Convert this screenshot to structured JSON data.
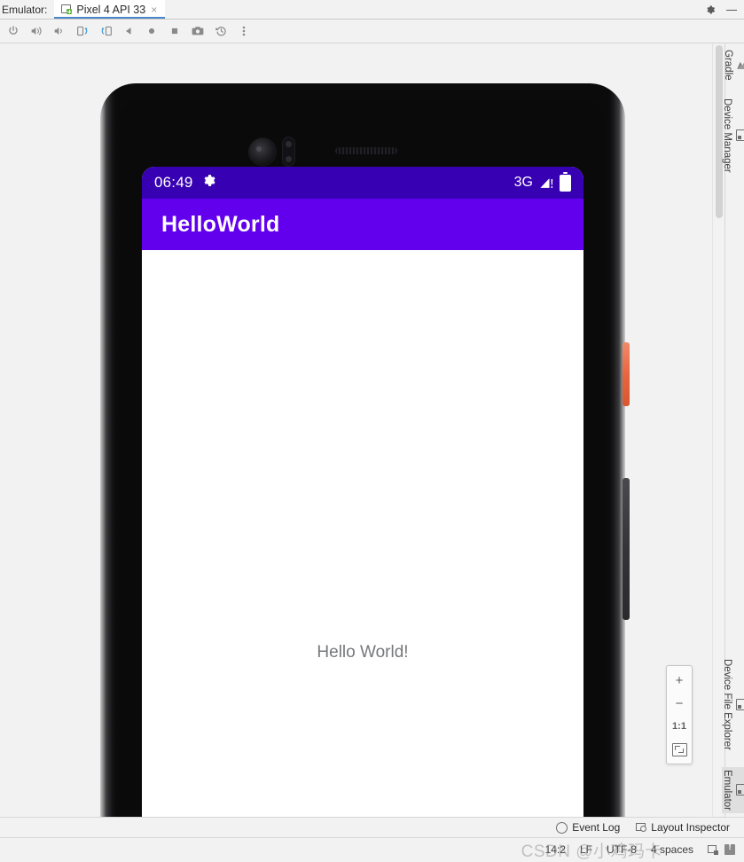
{
  "window": {
    "tool_window_label": "Emulator:",
    "settings_icon": "gear-icon",
    "minimize_icon": "minimize-icon"
  },
  "tabs": [
    {
      "label": "Pixel 4 API 33",
      "icon": "device-add-icon",
      "close": "×",
      "active": true
    }
  ],
  "emulator_toolbar": {
    "buttons": [
      {
        "name": "power-button",
        "icon": "power-icon",
        "label": "Power"
      },
      {
        "name": "volume-up-button",
        "icon": "volume-up-icon",
        "label": "Volume Up"
      },
      {
        "name": "volume-down-button",
        "icon": "volume-down-icon",
        "label": "Volume Down"
      },
      {
        "name": "rotate-left-button",
        "icon": "rotate-left-icon",
        "label": "Rotate Left"
      },
      {
        "name": "rotate-right-button",
        "icon": "rotate-right-icon",
        "label": "Rotate Right"
      },
      {
        "name": "back-button",
        "icon": "back-triangle-icon",
        "label": "Back"
      },
      {
        "name": "home-button",
        "icon": "home-circle-icon",
        "label": "Home"
      },
      {
        "name": "overview-button",
        "icon": "overview-square-icon",
        "label": "Overview"
      },
      {
        "name": "screenshot-button",
        "icon": "camera-icon",
        "label": "Take Screenshot"
      },
      {
        "name": "history-button",
        "icon": "history-icon",
        "label": "Snapshots"
      },
      {
        "name": "more-button",
        "icon": "more-vertical-icon",
        "label": "More"
      }
    ]
  },
  "device": {
    "name": "Pixel 4",
    "status_bar": {
      "time": "06:49",
      "settings_icon": "gear-icon",
      "network_type": "3G",
      "signal_icon": "signal-warning-icon",
      "battery_icon": "battery-full-icon",
      "background": "#3700B3",
      "foreground": "#FFFFFF"
    },
    "app_bar": {
      "title": "HelloWorld",
      "background": "#6200EE",
      "foreground": "#FFFFFF"
    },
    "content": {
      "text": "Hello World!",
      "text_color": "#77787A",
      "background": "#FFFFFF"
    },
    "hardware": {
      "power_button_color": "#E8663F",
      "volume_button_color": "#3A3A3C"
    }
  },
  "zoom_controls": {
    "zoom_in": "+",
    "zoom_out": "−",
    "actual_size": "1:1",
    "fit_icon": "fit-to-screen-icon"
  },
  "right_rail": {
    "top": [
      {
        "label": "Gradle",
        "icon": "gradle-icon"
      },
      {
        "label": "Device Manager",
        "icon": "device-manager-icon"
      }
    ],
    "bottom": [
      {
        "label": "Device File Explorer",
        "icon": "device-file-explorer-icon"
      },
      {
        "label": "Emulator",
        "icon": "emulator-icon",
        "active": true
      }
    ]
  },
  "status_bar": {
    "items": [
      {
        "label": "Event Log",
        "icon": "event-log-icon"
      },
      {
        "label": "Layout Inspector",
        "icon": "layout-inspector-icon"
      }
    ]
  },
  "editor_status": {
    "caret": "14:2",
    "line_separator": "LF",
    "encoding": "UTF-8",
    "indent": "4 spaces",
    "devices_icon": "devices-icon",
    "warning_icon": "warning-icon"
  },
  "watermark": {
    "text": "CSDN @小鸡玛卡"
  }
}
